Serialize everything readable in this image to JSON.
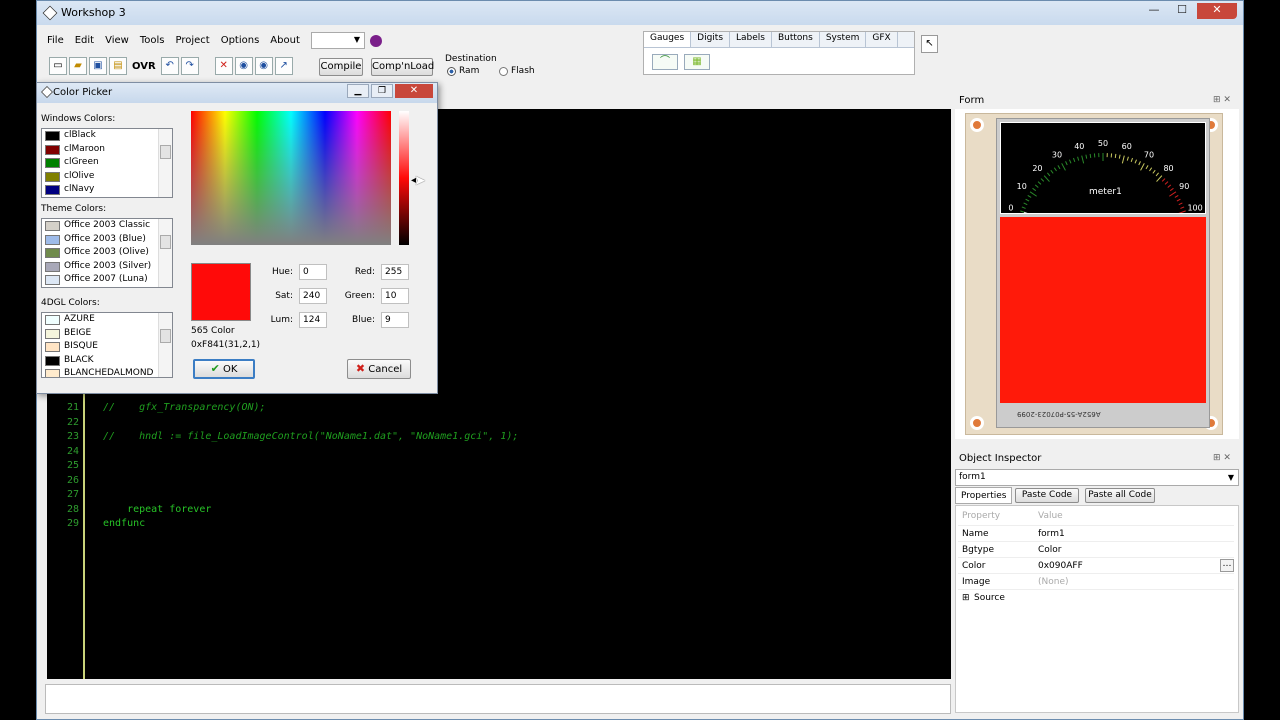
{
  "window": {
    "title": "Workshop 3",
    "controls": [
      "—",
      "☐",
      "✕"
    ]
  },
  "menu": [
    "File",
    "Edit",
    "View",
    "Tools",
    "Project",
    "Options",
    "About"
  ],
  "toolbar": {
    "ovr_label": "OVR",
    "compile_label": "Compile",
    "compnload_label": "Comp'nLoad",
    "destination_label": "Destination",
    "ram_label": "Ram",
    "flash_label": "Flash"
  },
  "widget_tabs": [
    "Gauges",
    "Digits",
    "Labels",
    "Buttons",
    "System",
    "GFX"
  ],
  "editor": {
    "lines": [
      {
        "n": "21",
        "text": "//    gfx_Transparency(ON);",
        "comment": true
      },
      {
        "n": "22",
        "text": "",
        "comment": false
      },
      {
        "n": "23",
        "text": "//    hndl := file_LoadImageControl(\"NoName1.dat\", \"NoName1.gci\", 1);",
        "comment": true
      },
      {
        "n": "24",
        "text": "",
        "comment": false
      },
      {
        "n": "25",
        "text": "",
        "comment": false
      },
      {
        "n": "26",
        "text": "",
        "comment": false
      },
      {
        "n": "27",
        "text": "",
        "comment": false
      },
      {
        "n": "28",
        "text": "    repeat forever",
        "comment": false
      },
      {
        "n": "29",
        "text": "endfunc",
        "comment": false
      }
    ]
  },
  "color_picker": {
    "title": "Color Picker",
    "windows_colors_label": "Windows Colors:",
    "windows_colors": [
      {
        "name": "clBlack",
        "color": "#000000"
      },
      {
        "name": "clMaroon",
        "color": "#800000"
      },
      {
        "name": "clGreen",
        "color": "#008000"
      },
      {
        "name": "clOlive",
        "color": "#808000"
      },
      {
        "name": "clNavy",
        "color": "#000080"
      }
    ],
    "theme_colors_label": "Theme Colors:",
    "theme_colors": [
      {
        "name": "Office 2003 Classic",
        "color": "#d4d0c8"
      },
      {
        "name": "Office 2003 (Blue)",
        "color": "#9ebbe9"
      },
      {
        "name": "Office 2003 (Olive)",
        "color": "#6f8a4c"
      },
      {
        "name": "Office 2003 (Silver)",
        "color": "#a8a8b8"
      },
      {
        "name": "Office 2007 (Luna)",
        "color": "#dce7f5"
      }
    ],
    "dgl_colors_label": "4DGL Colors:",
    "dgl_colors": [
      {
        "name": "AZURE",
        "color": "#f0ffff"
      },
      {
        "name": "BEIGE",
        "color": "#f5f5dc"
      },
      {
        "name": "BISQUE",
        "color": "#ffe4c4"
      },
      {
        "name": "BLACK",
        "color": "#000000"
      },
      {
        "name": "BLANCHEDALMOND",
        "color": "#ffebcd"
      }
    ],
    "preview_color": "#ff0a09",
    "color565_label": "565 Color",
    "color565_value": "0xF841(31,2,1)",
    "hue_label": "Hue:",
    "hue": "0",
    "sat_label": "Sat:",
    "sat": "240",
    "lum_label": "Lum:",
    "lum": "124",
    "red_label": "Red:",
    "red": "255",
    "green_label": "Green:",
    "green": "10",
    "blue_label": "Blue:",
    "blue": "9",
    "ok_label": "OK",
    "cancel_label": "Cancel"
  },
  "form_panel": {
    "title": "Form",
    "meter_label": "meter1",
    "scale_labels": [
      "0",
      "10",
      "20",
      "30",
      "40",
      "50",
      "60",
      "70",
      "80",
      "90",
      "100"
    ],
    "board_text": "A652A-55-P07023-2099",
    "bg_color": "#ff1a0a"
  },
  "object_inspector": {
    "title": "Object Inspector",
    "selected_object": "form1",
    "tabs": [
      "Properties",
      "Paste Code",
      "Paste all Code"
    ],
    "header": {
      "property": "Property",
      "value": "Value"
    },
    "rows": [
      {
        "property": "Name",
        "value": "form1"
      },
      {
        "property": "Bgtype",
        "value": "Color"
      },
      {
        "property": "Color",
        "value": "0x090AFF"
      },
      {
        "property": "Image",
        "value": "(None)"
      },
      {
        "property": "Source",
        "value": ""
      }
    ]
  }
}
